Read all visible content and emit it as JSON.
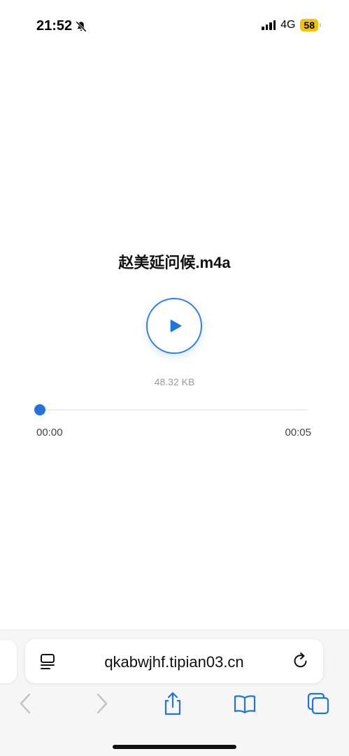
{
  "status_bar": {
    "time": "21:52",
    "network": "4G",
    "battery": "58"
  },
  "player": {
    "title": "赵美延问候.m4a",
    "file_size": "48.32 KB",
    "current_time": "00:00",
    "duration": "00:05",
    "progress": 0
  },
  "browser": {
    "url": "qkabwjhf.tipian03.cn"
  },
  "colors": {
    "accent": "#1f74e0",
    "battery": "#f2c200"
  }
}
